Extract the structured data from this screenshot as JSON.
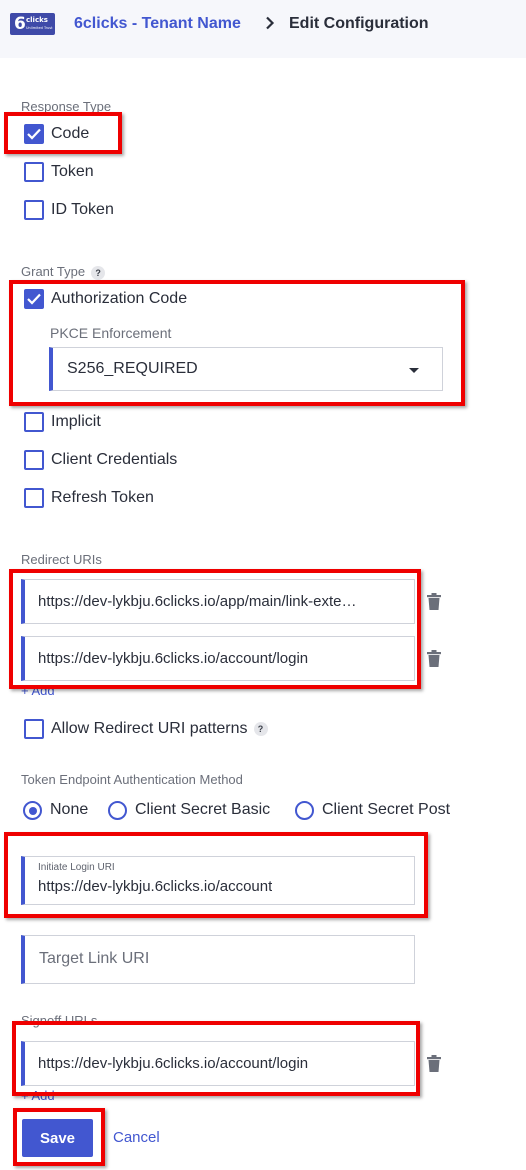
{
  "header": {
    "logo_number": "6",
    "logo_word": "clicks",
    "logo_tagline": "Unlimited Trust",
    "tenant_link": "6clicks - Tenant Name",
    "current_page": "Edit Configuration"
  },
  "response_type": {
    "label": "Response Type",
    "options": [
      {
        "label": "Code",
        "checked": true
      },
      {
        "label": "Token",
        "checked": false
      },
      {
        "label": "ID Token",
        "checked": false
      }
    ]
  },
  "grant_type": {
    "label": "Grant Type",
    "help_glyph": "?",
    "authorization_code": {
      "label": "Authorization Code",
      "checked": true
    },
    "pkce": {
      "label": "PKCE Enforcement",
      "value": "S256_REQUIRED"
    },
    "others": [
      {
        "label": "Implicit",
        "checked": false
      },
      {
        "label": "Client Credentials",
        "checked": false
      },
      {
        "label": "Refresh Token",
        "checked": false
      }
    ]
  },
  "redirect_uris": {
    "label": "Redirect URIs",
    "items": [
      "https://dev-lykbju.6clicks.io/app/main/link-exte…",
      "https://dev-lykbju.6clicks.io/account/login"
    ],
    "add_label": "+ Add",
    "allow_patterns": {
      "label": "Allow Redirect URI patterns",
      "checked": false,
      "help_glyph": "?"
    }
  },
  "token_auth": {
    "label": "Token Endpoint Authentication Method",
    "options": [
      {
        "label": "None",
        "selected": true
      },
      {
        "label": "Client Secret Basic",
        "selected": false
      },
      {
        "label": "Client Secret Post",
        "selected": false
      }
    ]
  },
  "initiate_login": {
    "label": "Initiate Login URI",
    "value": "https://dev-lykbju.6clicks.io/account"
  },
  "target_link": {
    "placeholder": "Target Link URI"
  },
  "signoff_urls": {
    "label": "Signoff URLs",
    "items": [
      "https://dev-lykbju.6clicks.io/account/login"
    ],
    "add_label": "+ Add"
  },
  "actions": {
    "save": "Save",
    "cancel": "Cancel"
  },
  "colors": {
    "accent": "#4257d0",
    "highlight": "#ef0000",
    "header_bg": "#f6f7fb"
  },
  "icons": [
    "check-icon",
    "chevron-right-icon",
    "caret-down-icon",
    "trash-icon",
    "help-icon"
  ]
}
